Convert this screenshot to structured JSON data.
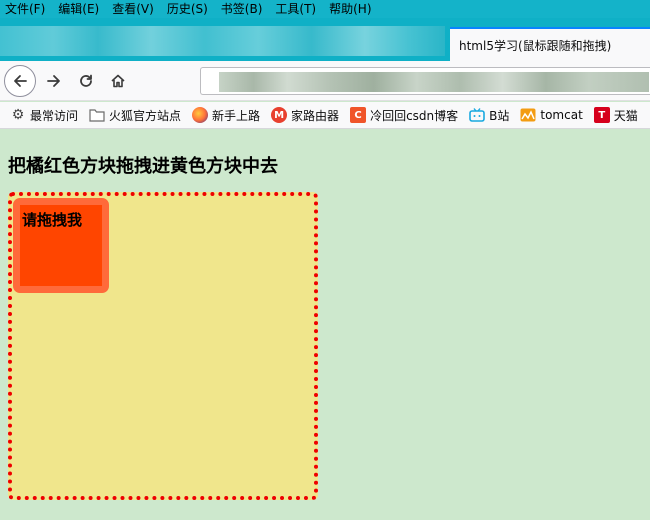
{
  "menu": {
    "items": [
      "文件(F)",
      "编辑(E)",
      "查看(V)",
      "历史(S)",
      "书签(B)",
      "工具(T)",
      "帮助(H)"
    ]
  },
  "tab": {
    "title": "html5学习(鼠标跟随和拖拽)"
  },
  "bookmarks": {
    "items": [
      {
        "label": "最常访问",
        "icon": "gear-icon",
        "color": "#444444"
      },
      {
        "label": "火狐官方站点",
        "icon": "folder-icon",
        "color": "#6b6b6b"
      },
      {
        "label": "新手上路",
        "icon": "firefox-icon",
        "color": "#e66000"
      },
      {
        "label": "家路由器",
        "icon": "router-icon",
        "color": "#e8402f"
      },
      {
        "label": "冷回回csdn博客",
        "icon": "csdn-icon",
        "color": "#f0552a"
      },
      {
        "label": "B站",
        "icon": "bilibili-icon",
        "color": "#19a9e0"
      },
      {
        "label": "tomcat",
        "icon": "tomcat-icon",
        "color": "#f39c12"
      },
      {
        "label": "天猫",
        "icon": "tmall-icon",
        "color": "#d6001c"
      }
    ]
  },
  "page": {
    "heading": "把橘红色方块拖拽进黄色方块中去",
    "drag_label": "请拖拽我"
  },
  "colors": {
    "page_bg": "#cde8cd",
    "target_bg": "#f0e68c",
    "target_border": "#ee0000",
    "drag_bg": "#ff4500",
    "toolbar_bg": "#14b3c9"
  }
}
